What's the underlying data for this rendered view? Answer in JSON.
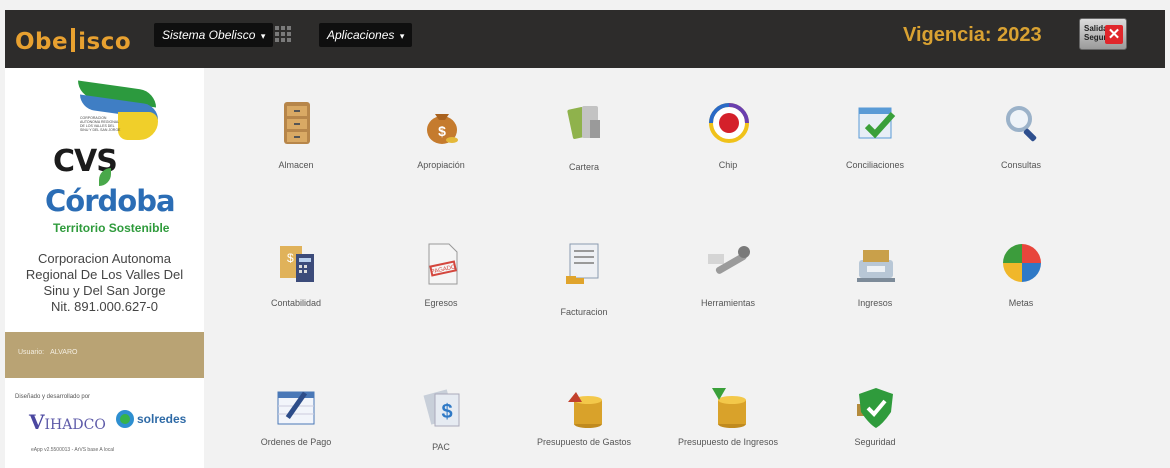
{
  "header": {
    "logo_left": "Obe",
    "logo_right": "isco",
    "menu_sistema": "Sistema Obelisco",
    "menu_aplicaciones": "Aplicaciones",
    "vigencia": "Vigencia: 2023",
    "salida_label": "Salida Segura"
  },
  "sidebar": {
    "cvs_flag_text": "CORPORACION AUTONOMA REGIONAL DE LOS VALLES DEL SINU Y DEL SAN JORGE",
    "cvs": "CVS",
    "cordoba": "Córdoba",
    "territorio": "Territorio Sostenible",
    "org_lines": [
      "Corporacion Autonoma",
      "Regional De Los Valles Del",
      "Sinu y Del San Jorge",
      "Nit. 891.000.627-0"
    ],
    "user_label": "Usuario:",
    "user_name": "ALVARO",
    "dev_text": "Diseñado y desarrollado por",
    "ihadco": "IHADCO",
    "solredes": "solredes",
    "footline": "eApp v2.5500013 - ArVS base A local"
  },
  "apps": [
    {
      "label": "Almacen",
      "icon": "cabinet-icon",
      "color": "#b7864a"
    },
    {
      "label": "Apropiación",
      "icon": "money-bag-icon",
      "color": "#c57b2e"
    },
    {
      "label": "Cartera",
      "icon": "wallet-icon",
      "color": "#8fb24c"
    },
    {
      "label": "Chip",
      "icon": "chip-target-icon",
      "color": "#d4202a"
    },
    {
      "label": "Conciliaciones",
      "icon": "checklist-icon",
      "color": "#5a9bd6"
    },
    {
      "label": "Consultas",
      "icon": "magnifier-icon",
      "color": "#9bb2c9"
    },
    {
      "label": "Contabilidad",
      "icon": "ledger-icon",
      "color": "#e0b25a"
    },
    {
      "label": "Egresos",
      "icon": "paid-invoice-icon",
      "color": "#d4473e"
    },
    {
      "label": "Facturacion",
      "icon": "invoice-icon",
      "color": "#8a9bb0"
    },
    {
      "label": "Herramientas",
      "icon": "wrench-icon",
      "color": "#9b9b9b"
    },
    {
      "label": "Ingresos",
      "icon": "cash-register-icon",
      "color": "#c9a04a"
    },
    {
      "label": "Metas",
      "icon": "pie-chart-icon",
      "color": "#3c9c3c"
    },
    {
      "label": "Ordenes de Pago",
      "icon": "calendar-pen-icon",
      "color": "#4a78b7"
    },
    {
      "label": "PAC",
      "icon": "pac-icon",
      "color": "#2f79c6"
    },
    {
      "label": "Presupuesto de Gastos",
      "icon": "coins-arrow-up-icon",
      "color": "#d9a22a"
    },
    {
      "label": "Presupuesto de Ingresos",
      "icon": "coins-arrow-down-icon",
      "color": "#d9a22a"
    },
    {
      "label": "Seguridad",
      "icon": "shield-check-icon",
      "color": "#2f9b3c"
    }
  ]
}
